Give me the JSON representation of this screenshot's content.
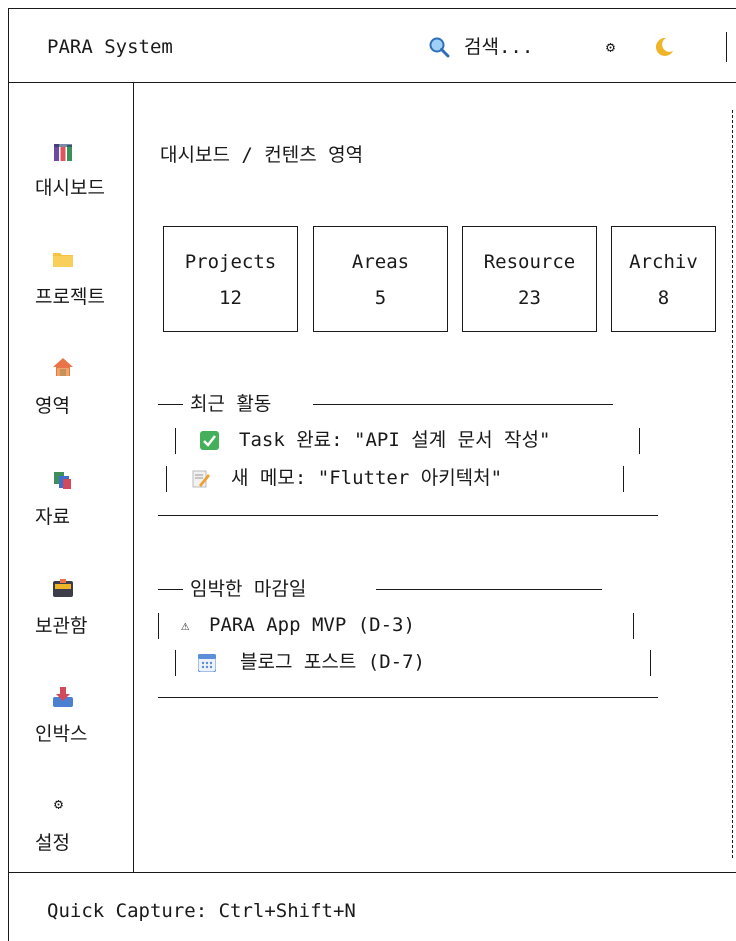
{
  "header": {
    "title": "PARA System",
    "search_placeholder": "검색...",
    "settings_glyph": "⚙",
    "theme_glyph": "🌙"
  },
  "sidebar": {
    "items": [
      {
        "label": "대시보드",
        "icon": "bar-chart-icon"
      },
      {
        "label": "프로젝트",
        "icon": "folder-icon"
      },
      {
        "label": "영역",
        "icon": "house-icon"
      },
      {
        "label": "자료",
        "icon": "books-icon"
      },
      {
        "label": "보관함",
        "icon": "archive-box-icon"
      },
      {
        "label": "인박스",
        "icon": "inbox-tray-icon"
      },
      {
        "label": "설정",
        "icon": "gear-icon"
      }
    ]
  },
  "main": {
    "breadcrumb": "대시보드 / 컨텐츠 영역",
    "stats": [
      {
        "label": "Projects",
        "value": "12"
      },
      {
        "label": "Areas",
        "value": "5"
      },
      {
        "label": "Resource",
        "value": "23"
      },
      {
        "label": "Archiv",
        "value": "8"
      }
    ],
    "recent_activity": {
      "title": "최근 활동",
      "items": [
        {
          "icon": "check-box-icon",
          "text": "Task 완료: \"API 설계 문서 작성\""
        },
        {
          "icon": "memo-icon",
          "text": "새 메모: \"Flutter 아키텍처\""
        }
      ]
    },
    "deadlines": {
      "title": "임박한 마감일",
      "items": [
        {
          "icon": "warning-icon",
          "glyph": "⚠",
          "text": "PARA App MVP (D-3)"
        },
        {
          "icon": "calendar-icon",
          "text": "블로그 포스트 (D-7)"
        }
      ]
    }
  },
  "footer": {
    "quick_capture": "Quick Capture: Ctrl+Shift+N"
  },
  "colors": {
    "check_green": "#44b05a",
    "folder_yellow": "#f5c242",
    "calendar_blue": "#5b8fd9",
    "moon_yellow": "#f0b429"
  }
}
